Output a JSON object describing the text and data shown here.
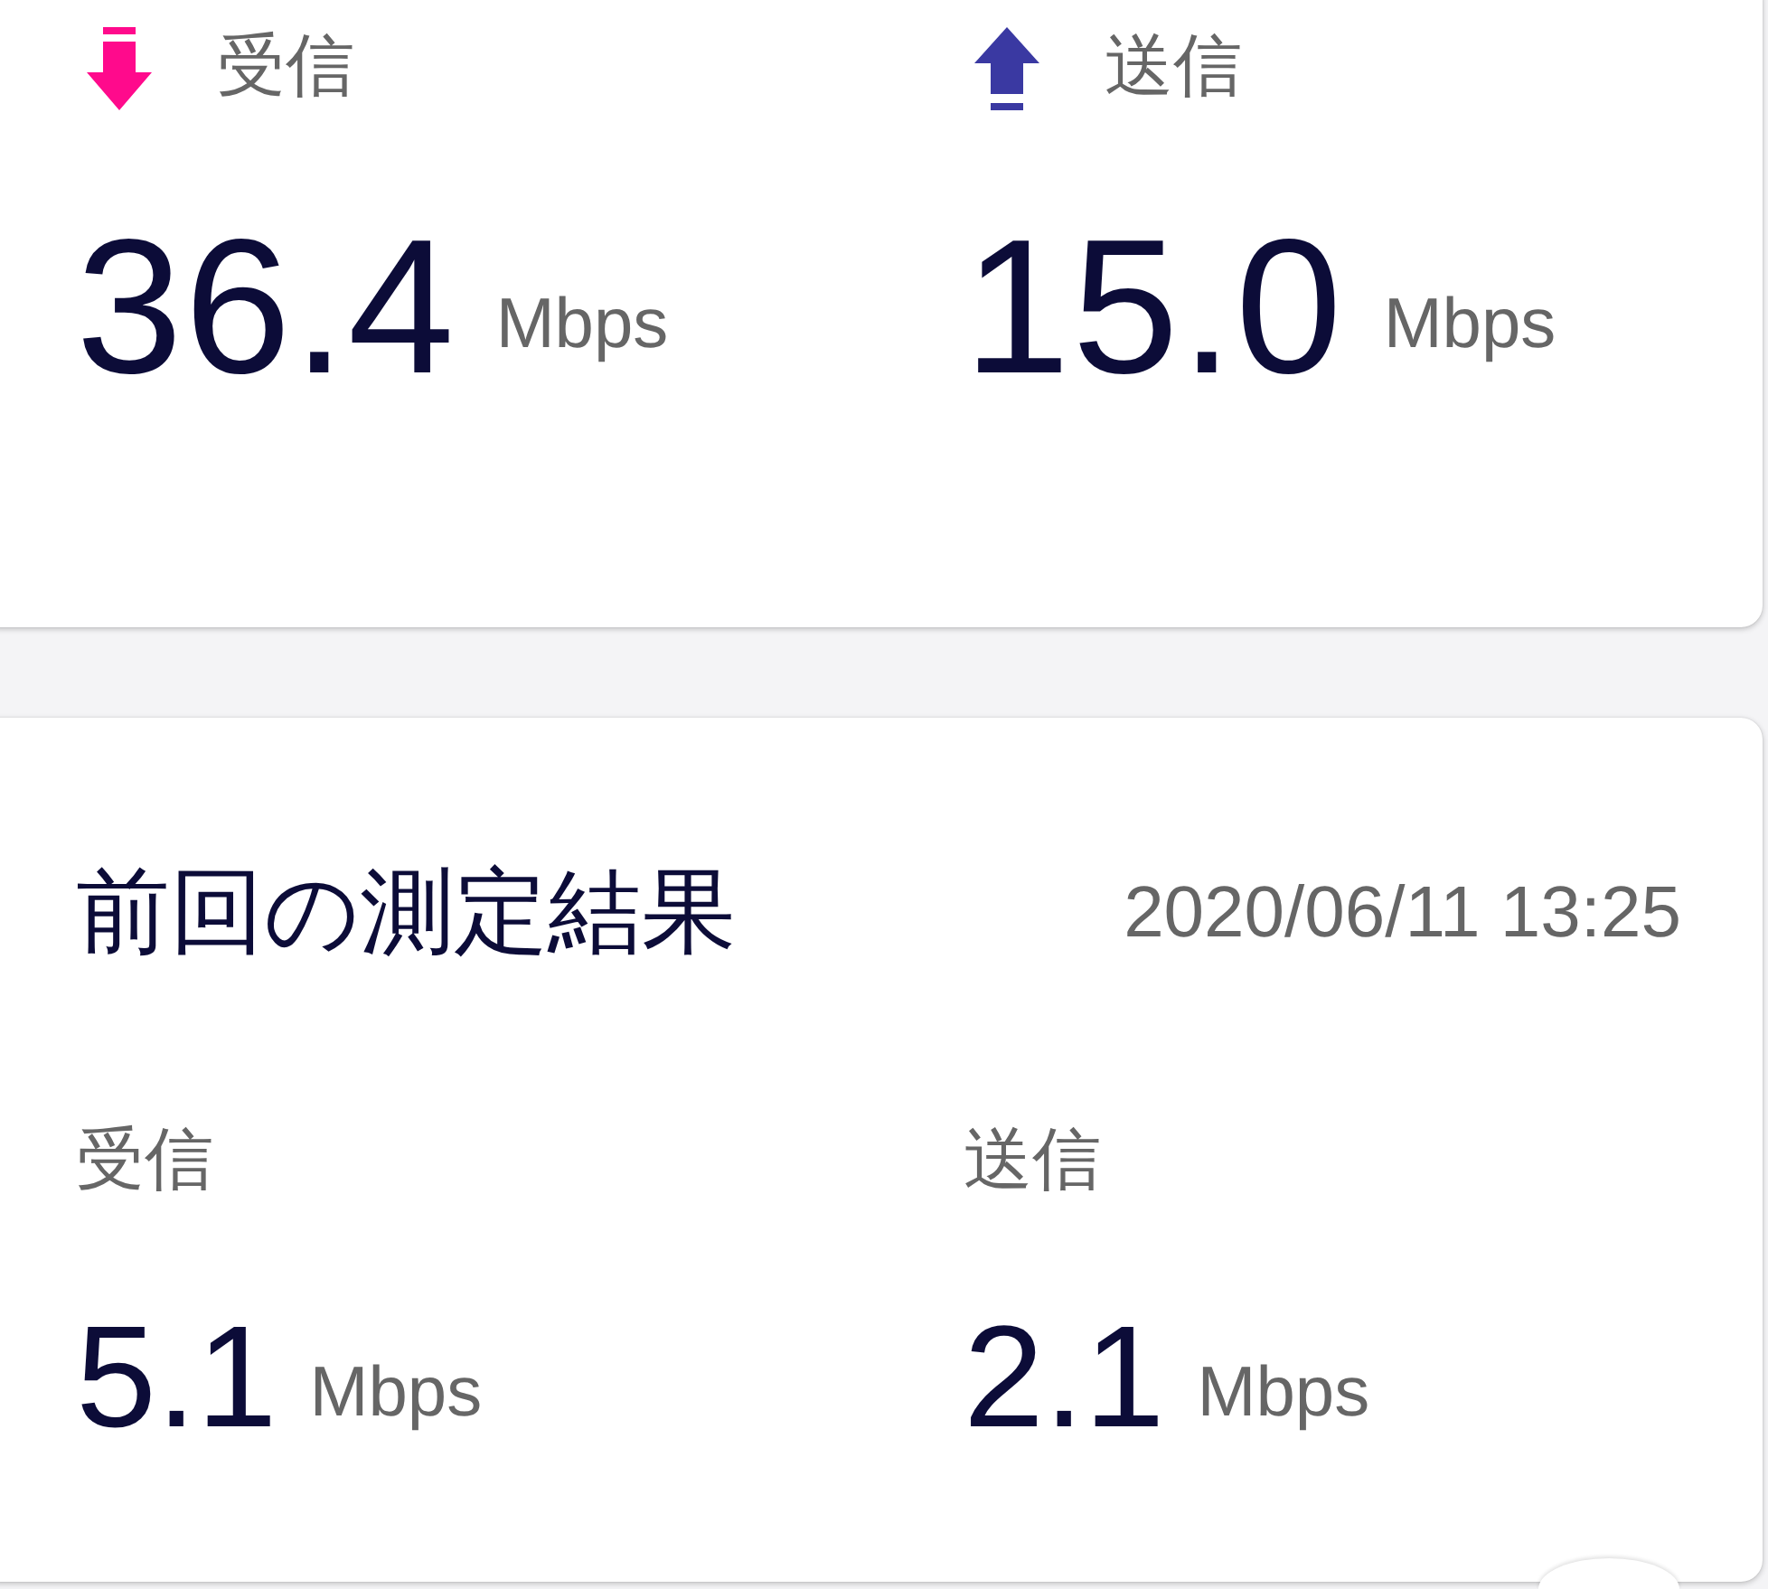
{
  "current": {
    "metrics": [
      {
        "kind": "download",
        "label": "受信",
        "value": "36.4",
        "unit": "Mbps"
      },
      {
        "kind": "upload",
        "label": "送信",
        "value": "15.0",
        "unit": "Mbps"
      }
    ]
  },
  "previous": {
    "title": "前回の測定結果",
    "datetime": "2020/06/11 13:25",
    "metrics": [
      {
        "label": "受信",
        "value": "5.1",
        "unit": "Mbps"
      },
      {
        "label": "送信",
        "value": "2.1",
        "unit": "Mbps"
      }
    ]
  }
}
